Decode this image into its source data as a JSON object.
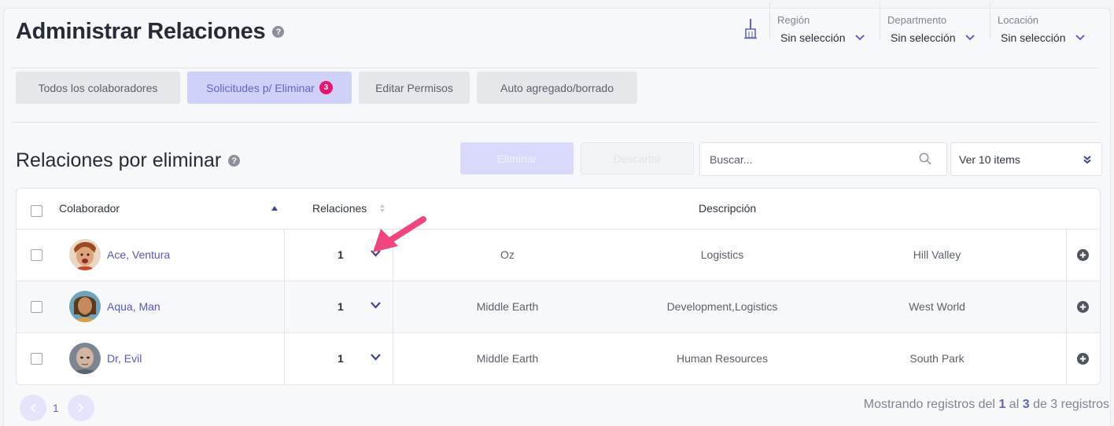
{
  "header": {
    "title": "Administrar Relaciones",
    "help": "?"
  },
  "filters": [
    {
      "label": "Región",
      "value": "Sin selección"
    },
    {
      "label": "Departmento",
      "value": "Sin selección"
    },
    {
      "label": "Locación",
      "value": "Sin selección"
    }
  ],
  "tabs": [
    {
      "label": "Todos los colaboradores"
    },
    {
      "label": "Solicitudes p/ Eliminar",
      "badge": "3"
    },
    {
      "label": "Editar Permisos"
    },
    {
      "label": "Auto agregado/borrado"
    }
  ],
  "section": {
    "title": "Relaciones por eliminar",
    "help": "?"
  },
  "toolbar": {
    "delete_label": "Eliminar",
    "discard_label": "Descartar",
    "search_placeholder": "Buscar...",
    "page_size": "Ver 10 items"
  },
  "table": {
    "columns": {
      "collaborator": "Colaborador",
      "relations": "Relaciones",
      "description": "Descripción"
    },
    "rows": [
      {
        "name": "Ace, Ventura",
        "count": "1",
        "region": "Oz",
        "department": "Logistics",
        "location": "Hill Valley"
      },
      {
        "name": "Aqua, Man",
        "count": "1",
        "region": "Middle Earth",
        "department": "Development,Logistics",
        "location": "West World"
      },
      {
        "name": "Dr, Evil",
        "count": "1",
        "region": "Middle Earth",
        "department": "Human Resources",
        "location": "South Park"
      }
    ]
  },
  "pagination": {
    "page": "1",
    "summary_prefix": "Mostrando registros del",
    "from": "1",
    "to_word": "al",
    "to": "3",
    "summary_suffix": "de 3 registros"
  },
  "colors": {
    "accent": "#5e64c9",
    "badge": "#e8156d",
    "arrow": "#f0457f"
  }
}
